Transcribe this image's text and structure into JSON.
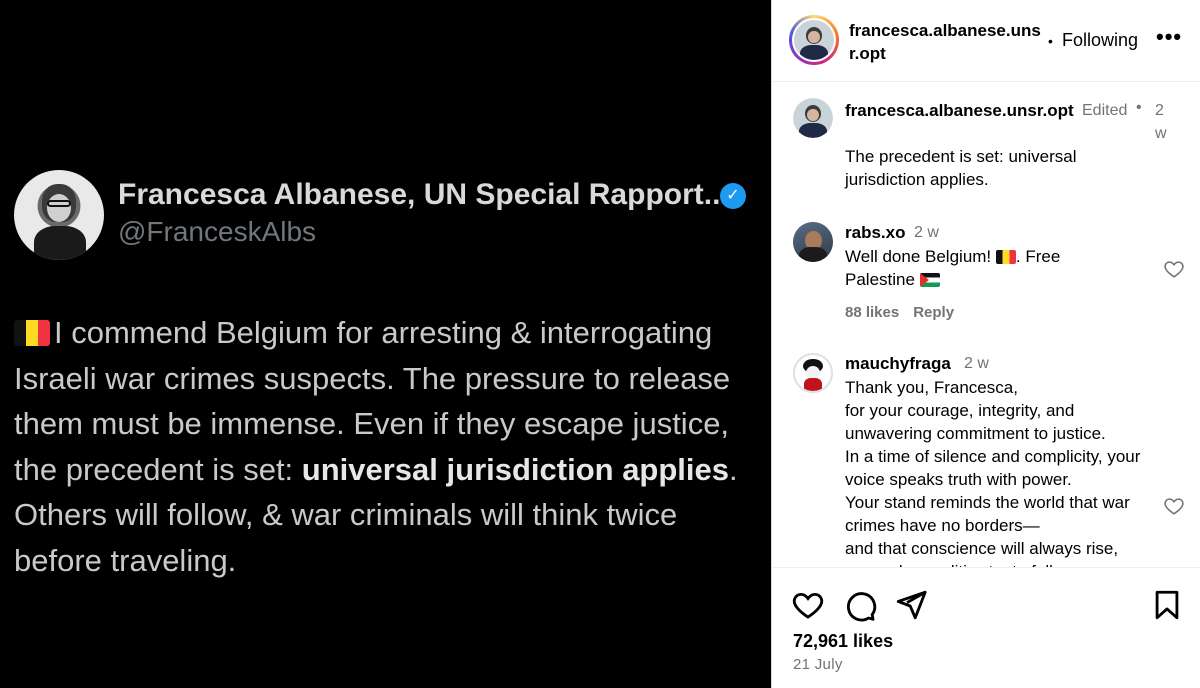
{
  "tweet": {
    "author_name": "Francesca Albanese, UN Special Rapport...",
    "verified_mark": "✓",
    "handle": "@FranceskAlbs",
    "text_part1": "I commend Belgium for arresting & interrogating Israeli war crimes suspects. The pressure to release them must be immense. Even if they escape justice, the precedent is set: ",
    "text_bold": "universal jurisdiction applies",
    "text_part2": ". Others will follow, & war criminals will think twice before traveling."
  },
  "header": {
    "username": "francesca.albanese.unsr.opt",
    "separator": "•",
    "follow_label": "Following",
    "more_label": "•••"
  },
  "caption": {
    "username": "francesca.albanese.unsr.opt",
    "edited": "Edited",
    "separator": "•",
    "time": "2w",
    "text": "The precedent is set: universal jurisdiction applies."
  },
  "comments": [
    {
      "username": "rabs.xo",
      "time": "2 w",
      "text_a": "Well done Belgium! ",
      "text_b": ". Free Palestine ",
      "likes": "88 likes",
      "reply": "Reply"
    },
    {
      "username": "mauchyfraga",
      "time": "2 w",
      "text": "Thank you, Francesca,\nfor your courage, integrity, and unwavering commitment to justice.\nIn a time of silence and complicity, your voice speaks truth with power.\nYour stand reminds the world that war crimes have no borders—\nand that conscience will always rise, even when politics try to fall."
    }
  ],
  "footer": {
    "likes": "72,961 likes",
    "date": "21 July"
  }
}
